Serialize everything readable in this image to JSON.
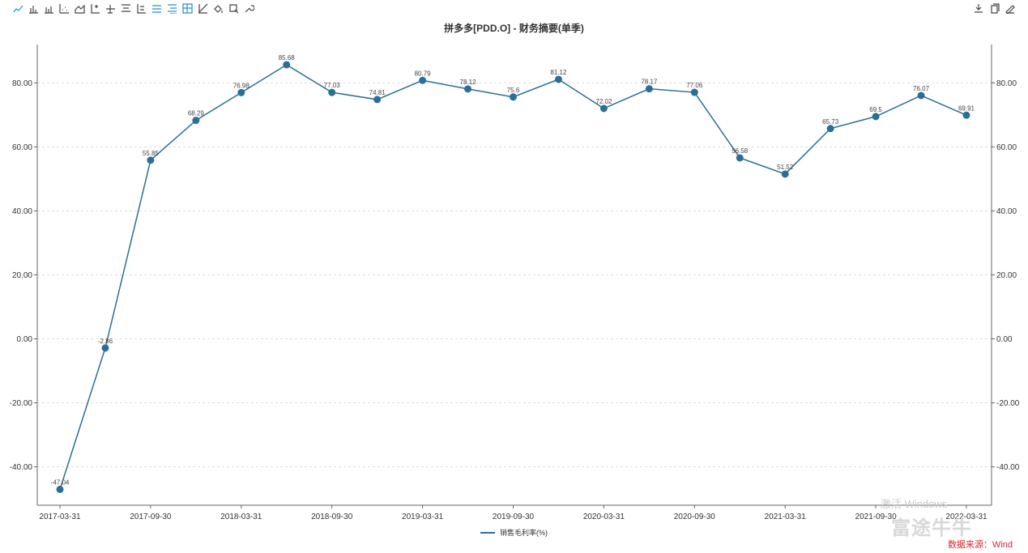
{
  "toolbar": {
    "left_icons": [
      "line-chart-icon",
      "bar-chart-icon",
      "stacked-bar-icon",
      "scatter-icon",
      "area-chart-icon",
      "axis-icon",
      "baseline-icon",
      "align-icon",
      "label-icon",
      "list-icon",
      "list-alt-icon",
      "grid-table-icon",
      "trend-icon",
      "fill-icon",
      "zoom-icon",
      "wrench-icon"
    ],
    "right_icons": [
      "download-icon",
      "copy-icon",
      "edit-icon"
    ]
  },
  "title": "拼多多[PDD.O] - 财务摘要(单季)",
  "legend_label": "销售毛利率(%)",
  "watermark_windows": "激活 Windows",
  "watermark_brand": "富途牛牛",
  "source_text": "数据来源：Wind",
  "colors": {
    "series": "#2a6f97",
    "grid": "#dddddd",
    "axis": "#666666"
  },
  "chart_data": {
    "type": "line",
    "title": "拼多多[PDD.O] - 财务摘要(单季)",
    "x": [
      "2017-03-31",
      "2017-06-30",
      "2017-09-30",
      "2017-12-31",
      "2018-03-31",
      "2018-06-30",
      "2018-09-30",
      "2018-12-31",
      "2019-03-31",
      "2019-06-30",
      "2019-09-30",
      "2019-12-31",
      "2020-03-31",
      "2020-06-30",
      "2020-09-30",
      "2020-12-31",
      "2021-03-31",
      "2021-06-30",
      "2021-09-30",
      "2021-12-31",
      "2022-03-31"
    ],
    "x_tick_labels": [
      "2017-03-31",
      "2017-09-30",
      "2018-03-31",
      "2018-09-30",
      "2019-03-31",
      "2019-09-30",
      "2020-03-31",
      "2020-09-30",
      "2021-03-31",
      "2021-09-30",
      "2022-03-31"
    ],
    "series": [
      {
        "name": "销售毛利率(%)",
        "values": [
          -47.04,
          -2.86,
          55.85,
          68.29,
          76.98,
          85.68,
          77.03,
          74.81,
          80.79,
          78.12,
          75.6,
          81.12,
          72.02,
          78.17,
          77.06,
          56.58,
          51.52,
          65.73,
          69.5,
          76.07,
          69.91
        ]
      }
    ],
    "data_labels": [
      "-47.04",
      "-2.86",
      "55.85",
      "68.29",
      "76.98",
      "85.68",
      "77.03",
      "74.81",
      "80.79",
      "78.12",
      "75.6",
      "81.12",
      "72.02",
      "78.17",
      "77.06",
      "56.58",
      "51.52",
      "65.73",
      "69.5",
      "76.07",
      "69.91"
    ],
    "y_ticks": [
      -40,
      -20,
      0,
      20,
      40,
      60,
      80
    ],
    "y_tick_labels": [
      "-40.00",
      "-20.00",
      "0.00",
      "20.00",
      "40.00",
      "60.00",
      "80.00"
    ],
    "ylim": [
      -52,
      92
    ],
    "grid": true,
    "legend_position": "bottom-center"
  }
}
